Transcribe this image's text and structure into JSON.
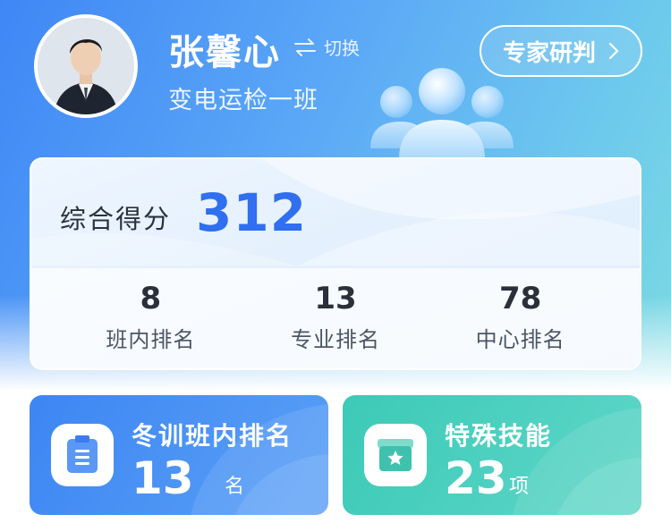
{
  "header": {
    "user_name": "张馨心",
    "switch_label": "切换",
    "team": "变电运检一班",
    "expert_button": "专家研判"
  },
  "score": {
    "label": "综合得分",
    "value": "312"
  },
  "ranks": [
    {
      "value": "8",
      "label": "班内排名"
    },
    {
      "value": "13",
      "label": "专业排名"
    },
    {
      "value": "78",
      "label": "中心排名"
    }
  ],
  "tiles": [
    {
      "title": "冬训班内排名",
      "value": "13",
      "unit": "名",
      "icon": "clipboard-icon",
      "color": "#3d86f3"
    },
    {
      "title": "特殊技能",
      "value": "23",
      "unit": "项",
      "icon": "star-box-icon",
      "color": "#3ccab7"
    }
  ]
}
